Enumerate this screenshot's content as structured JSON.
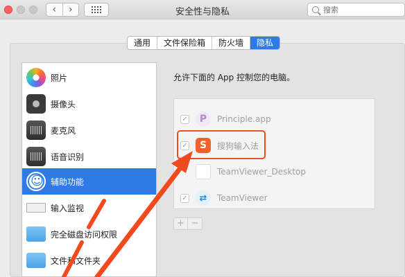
{
  "window": {
    "title": "安全性与隐私",
    "back_glyph": "‹",
    "forward_glyph": "›"
  },
  "search": {
    "placeholder": "搜索"
  },
  "tabs": [
    {
      "label": "通用",
      "active": false
    },
    {
      "label": "文件保险箱",
      "active": false
    },
    {
      "label": "防火墙",
      "active": false
    },
    {
      "label": "隐私",
      "active": true
    }
  ],
  "sidebar": {
    "items": [
      {
        "label": "照片",
        "icon": "photos-icon"
      },
      {
        "label": "摄像头",
        "icon": "camera-icon"
      },
      {
        "label": "麦克风",
        "icon": "microphone-icon"
      },
      {
        "label": "语音识别",
        "icon": "speech-recognition-icon"
      },
      {
        "label": "辅助功能",
        "icon": "accessibility-icon",
        "selected": true
      },
      {
        "label": "输入监视",
        "icon": "keyboard-icon"
      },
      {
        "label": "完全磁盘访问权限",
        "icon": "folder-icon"
      },
      {
        "label": "文件和文件夹",
        "icon": "folder-icon"
      }
    ]
  },
  "permission": {
    "description": "允许下面的 App 控制您的电脑。",
    "apps": [
      {
        "name": "Principle.app",
        "checked": true,
        "icon": "principle-icon"
      },
      {
        "name": "搜狗输入法",
        "checked": true,
        "icon": "sogou-icon"
      },
      {
        "name": "TeamViewer_Desktop",
        "checked": false,
        "icon": "document-icon"
      },
      {
        "name": "TeamViewer",
        "checked": true,
        "icon": "teamviewer-icon"
      }
    ],
    "add_label": "+",
    "remove_label": "−"
  },
  "colors": {
    "accent": "#2f7ae5",
    "annotation": "#f04a1e"
  }
}
